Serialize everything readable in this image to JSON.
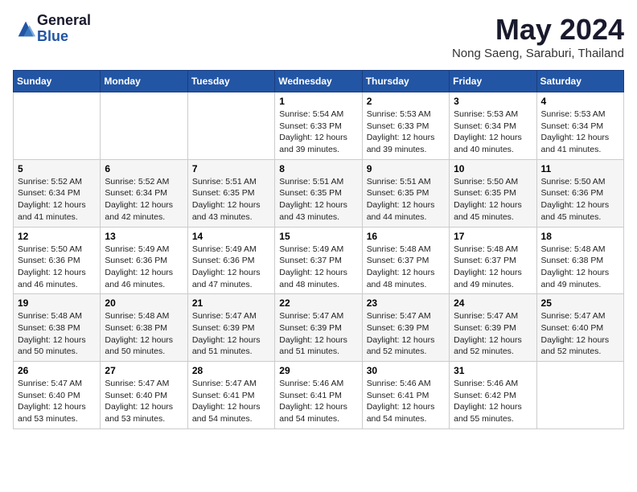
{
  "logo": {
    "general": "General",
    "blue": "Blue"
  },
  "header": {
    "month": "May 2024",
    "location": "Nong Saeng, Saraburi, Thailand"
  },
  "weekdays": [
    "Sunday",
    "Monday",
    "Tuesday",
    "Wednesday",
    "Thursday",
    "Friday",
    "Saturday"
  ],
  "weeks": [
    [
      {
        "day": "",
        "info": ""
      },
      {
        "day": "",
        "info": ""
      },
      {
        "day": "",
        "info": ""
      },
      {
        "day": "1",
        "info": "Sunrise: 5:54 AM\nSunset: 6:33 PM\nDaylight: 12 hours\nand 39 minutes."
      },
      {
        "day": "2",
        "info": "Sunrise: 5:53 AM\nSunset: 6:33 PM\nDaylight: 12 hours\nand 39 minutes."
      },
      {
        "day": "3",
        "info": "Sunrise: 5:53 AM\nSunset: 6:34 PM\nDaylight: 12 hours\nand 40 minutes."
      },
      {
        "day": "4",
        "info": "Sunrise: 5:53 AM\nSunset: 6:34 PM\nDaylight: 12 hours\nand 41 minutes."
      }
    ],
    [
      {
        "day": "5",
        "info": "Sunrise: 5:52 AM\nSunset: 6:34 PM\nDaylight: 12 hours\nand 41 minutes."
      },
      {
        "day": "6",
        "info": "Sunrise: 5:52 AM\nSunset: 6:34 PM\nDaylight: 12 hours\nand 42 minutes."
      },
      {
        "day": "7",
        "info": "Sunrise: 5:51 AM\nSunset: 6:35 PM\nDaylight: 12 hours\nand 43 minutes."
      },
      {
        "day": "8",
        "info": "Sunrise: 5:51 AM\nSunset: 6:35 PM\nDaylight: 12 hours\nand 43 minutes."
      },
      {
        "day": "9",
        "info": "Sunrise: 5:51 AM\nSunset: 6:35 PM\nDaylight: 12 hours\nand 44 minutes."
      },
      {
        "day": "10",
        "info": "Sunrise: 5:50 AM\nSunset: 6:35 PM\nDaylight: 12 hours\nand 45 minutes."
      },
      {
        "day": "11",
        "info": "Sunrise: 5:50 AM\nSunset: 6:36 PM\nDaylight: 12 hours\nand 45 minutes."
      }
    ],
    [
      {
        "day": "12",
        "info": "Sunrise: 5:50 AM\nSunset: 6:36 PM\nDaylight: 12 hours\nand 46 minutes."
      },
      {
        "day": "13",
        "info": "Sunrise: 5:49 AM\nSunset: 6:36 PM\nDaylight: 12 hours\nand 46 minutes."
      },
      {
        "day": "14",
        "info": "Sunrise: 5:49 AM\nSunset: 6:36 PM\nDaylight: 12 hours\nand 47 minutes."
      },
      {
        "day": "15",
        "info": "Sunrise: 5:49 AM\nSunset: 6:37 PM\nDaylight: 12 hours\nand 48 minutes."
      },
      {
        "day": "16",
        "info": "Sunrise: 5:48 AM\nSunset: 6:37 PM\nDaylight: 12 hours\nand 48 minutes."
      },
      {
        "day": "17",
        "info": "Sunrise: 5:48 AM\nSunset: 6:37 PM\nDaylight: 12 hours\nand 49 minutes."
      },
      {
        "day": "18",
        "info": "Sunrise: 5:48 AM\nSunset: 6:38 PM\nDaylight: 12 hours\nand 49 minutes."
      }
    ],
    [
      {
        "day": "19",
        "info": "Sunrise: 5:48 AM\nSunset: 6:38 PM\nDaylight: 12 hours\nand 50 minutes."
      },
      {
        "day": "20",
        "info": "Sunrise: 5:48 AM\nSunset: 6:38 PM\nDaylight: 12 hours\nand 50 minutes."
      },
      {
        "day": "21",
        "info": "Sunrise: 5:47 AM\nSunset: 6:39 PM\nDaylight: 12 hours\nand 51 minutes."
      },
      {
        "day": "22",
        "info": "Sunrise: 5:47 AM\nSunset: 6:39 PM\nDaylight: 12 hours\nand 51 minutes."
      },
      {
        "day": "23",
        "info": "Sunrise: 5:47 AM\nSunset: 6:39 PM\nDaylight: 12 hours\nand 52 minutes."
      },
      {
        "day": "24",
        "info": "Sunrise: 5:47 AM\nSunset: 6:39 PM\nDaylight: 12 hours\nand 52 minutes."
      },
      {
        "day": "25",
        "info": "Sunrise: 5:47 AM\nSunset: 6:40 PM\nDaylight: 12 hours\nand 52 minutes."
      }
    ],
    [
      {
        "day": "26",
        "info": "Sunrise: 5:47 AM\nSunset: 6:40 PM\nDaylight: 12 hours\nand 53 minutes."
      },
      {
        "day": "27",
        "info": "Sunrise: 5:47 AM\nSunset: 6:40 PM\nDaylight: 12 hours\nand 53 minutes."
      },
      {
        "day": "28",
        "info": "Sunrise: 5:47 AM\nSunset: 6:41 PM\nDaylight: 12 hours\nand 54 minutes."
      },
      {
        "day": "29",
        "info": "Sunrise: 5:46 AM\nSunset: 6:41 PM\nDaylight: 12 hours\nand 54 minutes."
      },
      {
        "day": "30",
        "info": "Sunrise: 5:46 AM\nSunset: 6:41 PM\nDaylight: 12 hours\nand 54 minutes."
      },
      {
        "day": "31",
        "info": "Sunrise: 5:46 AM\nSunset: 6:42 PM\nDaylight: 12 hours\nand 55 minutes."
      },
      {
        "day": "",
        "info": ""
      }
    ]
  ]
}
